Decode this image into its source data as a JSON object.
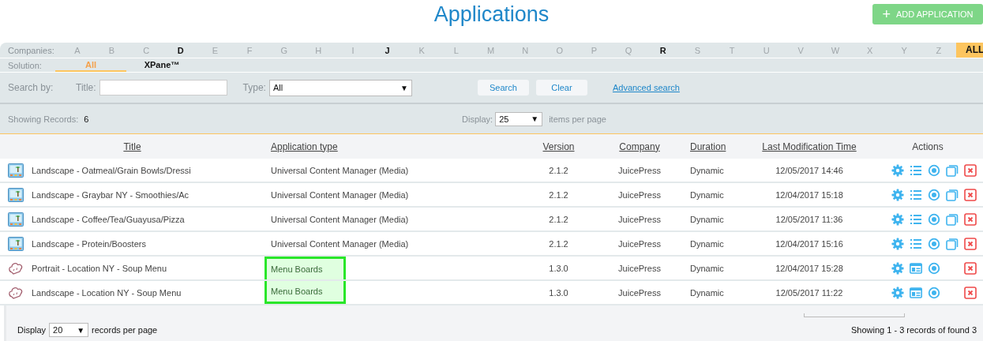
{
  "page": {
    "title": "Applications"
  },
  "add_button": {
    "icon": "+",
    "label": "ADD APPLICATION"
  },
  "companies": {
    "label": "Companies:",
    "letters": [
      {
        "label": "A",
        "available": false,
        "selected": false
      },
      {
        "label": "B",
        "available": false,
        "selected": false
      },
      {
        "label": "C",
        "available": false,
        "selected": false
      },
      {
        "label": "D",
        "available": true,
        "selected": false
      },
      {
        "label": "E",
        "available": false,
        "selected": false
      },
      {
        "label": "F",
        "available": false,
        "selected": false
      },
      {
        "label": "G",
        "available": false,
        "selected": false
      },
      {
        "label": "H",
        "available": false,
        "selected": false
      },
      {
        "label": "I",
        "available": false,
        "selected": false
      },
      {
        "label": "J",
        "available": true,
        "selected": false
      },
      {
        "label": "K",
        "available": false,
        "selected": false
      },
      {
        "label": "L",
        "available": false,
        "selected": false
      },
      {
        "label": "M",
        "available": false,
        "selected": false
      },
      {
        "label": "N",
        "available": false,
        "selected": false
      },
      {
        "label": "O",
        "available": false,
        "selected": false
      },
      {
        "label": "P",
        "available": false,
        "selected": false
      },
      {
        "label": "Q",
        "available": false,
        "selected": false
      },
      {
        "label": "R",
        "available": true,
        "selected": false
      },
      {
        "label": "S",
        "available": false,
        "selected": false
      },
      {
        "label": "T",
        "available": false,
        "selected": false
      },
      {
        "label": "U",
        "available": false,
        "selected": false
      },
      {
        "label": "V",
        "available": false,
        "selected": false
      },
      {
        "label": "W",
        "available": false,
        "selected": false
      },
      {
        "label": "X",
        "available": false,
        "selected": false
      },
      {
        "label": "Y",
        "available": false,
        "selected": false
      },
      {
        "label": "Z",
        "available": false,
        "selected": false
      },
      {
        "label": "ALL",
        "available": true,
        "selected": true
      }
    ]
  },
  "solution": {
    "label": "Solution:",
    "tabs": [
      {
        "label": "All",
        "selected": true
      },
      {
        "label": "XPane™",
        "selected": false
      }
    ]
  },
  "search": {
    "label": "Search by:",
    "title_label": "Title:",
    "type_label": "Type:",
    "type_value": "All",
    "dropdown_arrow": "▼",
    "search_button": "Search",
    "clear_button": "Clear",
    "advanced_link": "Advanced search"
  },
  "summary": {
    "label": "Showing Records:",
    "count": "6",
    "display_label": "Display:",
    "display_value": "25",
    "display_arrow": "▼",
    "suffix": "items per page"
  },
  "table": {
    "columns": [
      "Title",
      "Application type",
      "Version",
      "Company",
      "Duration",
      "Last Modification Time",
      "Actions"
    ],
    "rows": [
      {
        "kind": "media",
        "title": "Landscape - Oatmeal/Grain Bowls/Dressi",
        "type": "Universal Content Manager (Media)",
        "highlighted": false,
        "version": "2.1.2",
        "company": "JuicePress",
        "duration": "Dynamic",
        "modified": "12/05/2017 14:46",
        "actions": [
          {
            "kind": "settings"
          },
          {
            "kind": "list"
          },
          {
            "kind": "view"
          },
          {
            "kind": "copy"
          },
          {
            "kind": "delete"
          }
        ]
      },
      {
        "kind": "media",
        "title": "Landscape - Graybar NY - Smoothies/Ac",
        "type": "Universal Content Manager (Media)",
        "highlighted": false,
        "version": "2.1.2",
        "company": "JuicePress",
        "duration": "Dynamic",
        "modified": "12/04/2017 15:18",
        "actions": [
          {
            "kind": "settings"
          },
          {
            "kind": "list"
          },
          {
            "kind": "view"
          },
          {
            "kind": "copy"
          },
          {
            "kind": "delete"
          }
        ]
      },
      {
        "kind": "media",
        "title": "Landscape - Coffee/Tea/Guayusa/Pizza",
        "type": "Universal Content Manager (Media)",
        "highlighted": false,
        "version": "2.1.2",
        "company": "JuicePress",
        "duration": "Dynamic",
        "modified": "12/05/2017 11:36",
        "actions": [
          {
            "kind": "settings"
          },
          {
            "kind": "list"
          },
          {
            "kind": "view"
          },
          {
            "kind": "copy"
          },
          {
            "kind": "delete"
          }
        ]
      },
      {
        "kind": "media",
        "title": "Landscape - Protein/Boosters",
        "type": "Universal Content Manager (Media)",
        "highlighted": false,
        "version": "2.1.2",
        "company": "JuicePress",
        "duration": "Dynamic",
        "modified": "12/04/2017 15:16",
        "actions": [
          {
            "kind": "settings"
          },
          {
            "kind": "list"
          },
          {
            "kind": "view"
          },
          {
            "kind": "copy"
          },
          {
            "kind": "delete"
          }
        ]
      },
      {
        "kind": "menu",
        "title": "Portrait - Location NY - Soup Menu",
        "type": "Menu Boards",
        "highlighted": true,
        "version": "1.3.0",
        "company": "JuicePress",
        "duration": "Dynamic",
        "modified": "12/04/2017 15:28",
        "actions": [
          {
            "kind": "settings"
          },
          {
            "kind": "layout"
          },
          {
            "kind": "view"
          },
          {
            "kind": "delete"
          }
        ]
      },
      {
        "kind": "menu",
        "title": "Landscape - Location NY - Soup Menu",
        "type": "Menu Boards",
        "highlighted": true,
        "version": "1.3.0",
        "company": "JuicePress",
        "duration": "Dynamic",
        "modified": "12/05/2017 11:22",
        "actions": [
          {
            "kind": "settings"
          },
          {
            "kind": "layout"
          },
          {
            "kind": "view"
          },
          {
            "kind": "delete"
          }
        ]
      }
    ]
  },
  "footer": {
    "display_label": "Display",
    "display_value": "20",
    "display_arrow": "▼",
    "suffix": "records per page",
    "status": "Showing 1 - 3 records of found 3"
  }
}
